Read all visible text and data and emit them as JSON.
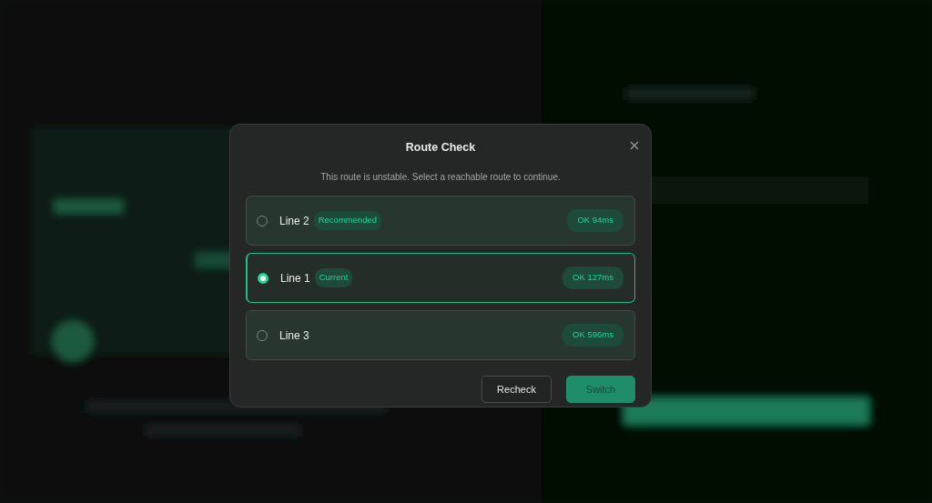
{
  "dialog": {
    "title": "Route Check",
    "subtitle": "This route is unstable. Select a reachable route to continue.",
    "routes": [
      {
        "name": "Line 2",
        "tag": "Recommended",
        "status": "OK 94ms",
        "selected": false
      },
      {
        "name": "Line 1",
        "tag": "Current",
        "status": "OK 127ms",
        "selected": true
      },
      {
        "name": "Line 3",
        "status": "OK 596ms",
        "selected": false
      }
    ],
    "buttons": [
      {
        "label": "Recheck",
        "kind": "secondary",
        "disabled": false
      },
      {
        "label": "Switch",
        "kind": "primary",
        "disabled": true
      }
    ]
  }
}
